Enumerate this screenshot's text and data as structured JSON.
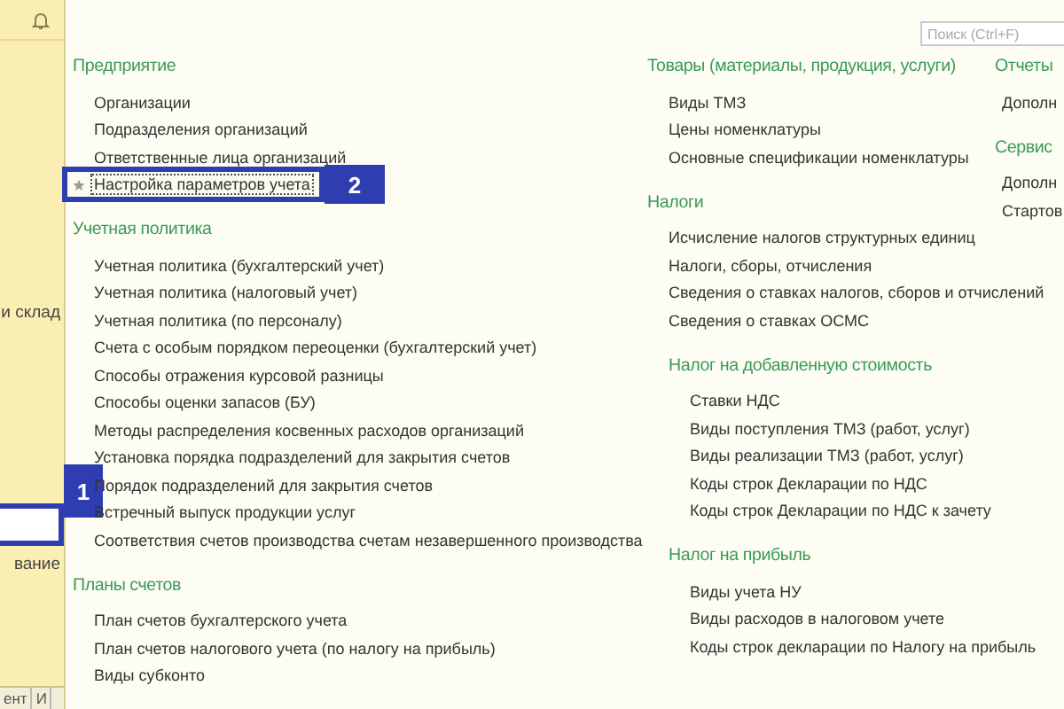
{
  "sidebar": {
    "items": [
      {
        "label": "и склад",
        "selected": false
      },
      {
        "selected": true
      },
      {
        "label": "вание",
        "selected": false
      }
    ],
    "bottom_tabs": [
      "ент",
      "И"
    ]
  },
  "search": {
    "placeholder": "Поиск (Ctrl+F)"
  },
  "columns": [
    {
      "groups": [
        {
          "title": "Предприятие",
          "items": [
            {
              "label": "Организации",
              "starred": false,
              "focused": false
            },
            {
              "label": "Подразделения организаций",
              "starred": false,
              "focused": false
            },
            {
              "label": "Ответственные лица организаций",
              "starred": false,
              "focused": false
            },
            {
              "label": "Настройка параметров учета",
              "starred": true,
              "focused": true
            }
          ]
        },
        {
          "title": "Учетная политика",
          "items": [
            {
              "label": "Учетная политика (бухгалтерский учет)"
            },
            {
              "label": "Учетная политика (налоговый учет)"
            },
            {
              "label": "Учетная политика (по персоналу)"
            },
            {
              "label": "Счета с особым порядком переоценки (бухгалтерский учет)"
            },
            {
              "label": "Способы отражения курсовой разницы"
            },
            {
              "label": "Способы оценки запасов (БУ)"
            },
            {
              "label": "Методы распределения косвенных расходов организаций"
            },
            {
              "label": "Установка порядка подразделений для закрытия счетов"
            },
            {
              "label": "Порядок подразделений для закрытия счетов"
            },
            {
              "label": "Встречный выпуск продукции услуг"
            },
            {
              "label": "Соответствия счетов производства счетам незавершенного производства"
            }
          ]
        },
        {
          "title": "Планы счетов",
          "items": [
            {
              "label": "План счетов бухгалтерского учета"
            },
            {
              "label": "План счетов налогового учета (по налогу на прибыль)"
            },
            {
              "label": "Виды субконто"
            }
          ]
        }
      ]
    },
    {
      "groups": [
        {
          "title": "Товары (материалы, продукция, услуги)",
          "items": [
            {
              "label": "Виды ТМЗ"
            },
            {
              "label": "Цены номенклатуры"
            },
            {
              "label": "Основные спецификации номенклатуры"
            }
          ]
        },
        {
          "title": "Налоги",
          "items": [
            {
              "label": "Исчисление налогов структурных единиц"
            },
            {
              "label": "Налоги, сборы, отчисления"
            },
            {
              "label": "Сведения о ставках налогов, сборов и отчислений"
            },
            {
              "label": "Сведения о ставках ОСМС"
            }
          ],
          "children": [
            {
              "title": "Налог на добавленную стоимость",
              "items": [
                {
                  "label": "Ставки НДС"
                },
                {
                  "label": "Виды поступления ТМЗ (работ, услуг)"
                },
                {
                  "label": "Виды реализации ТМЗ (работ, услуг)"
                },
                {
                  "label": "Коды строк Декларации по НДС"
                },
                {
                  "label": "Коды строк Декларации по НДС к зачету"
                }
              ]
            },
            {
              "title": "Налог на прибыль",
              "items": [
                {
                  "label": "Виды учета НУ"
                },
                {
                  "label": "Виды расходов в налоговом учете"
                },
                {
                  "label": "Коды строк декларации по Налогу на прибыль"
                }
              ]
            }
          ]
        }
      ]
    },
    {
      "groups": [
        {
          "title": "Отчеты",
          "items": [
            {
              "label": "Дополн"
            }
          ]
        },
        {
          "title": "Сервис",
          "items": [
            {
              "label": "Дополн"
            },
            {
              "label": "Стартов"
            }
          ]
        }
      ]
    }
  ],
  "callouts": [
    {
      "number": "2"
    },
    {
      "number": "1"
    }
  ]
}
